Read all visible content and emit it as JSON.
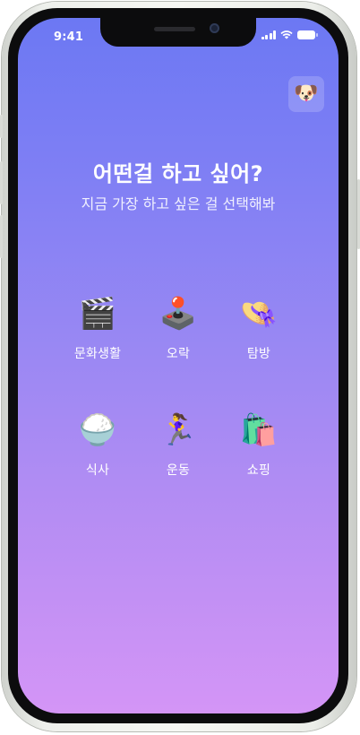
{
  "status_bar": {
    "time": "9:41"
  },
  "header": {
    "avatar_icon": "dog-face-icon",
    "avatar_glyph": "🐶"
  },
  "main": {
    "title": "어떤걸 하고 싶어?",
    "subtitle": "지금 가장 하고 싶은 걸 선택해봐"
  },
  "categories": [
    {
      "label": "문화생활",
      "icon": "clapper-board-icon",
      "glyph": "🎬"
    },
    {
      "label": "오락",
      "icon": "joystick-icon",
      "glyph": "🕹️"
    },
    {
      "label": "탐방",
      "icon": "sun-hat-icon",
      "glyph": "👒"
    },
    {
      "label": "식사",
      "icon": "rice-bowl-icon",
      "glyph": "🍚"
    },
    {
      "label": "운동",
      "icon": "running-person-icon",
      "glyph": "🏃‍♀️"
    },
    {
      "label": "쇼핑",
      "icon": "shopping-bags-icon",
      "glyph": "🛍️"
    }
  ],
  "colors": {
    "gradient_top": "#6c78f3",
    "gradient_bottom": "#d495f6"
  }
}
